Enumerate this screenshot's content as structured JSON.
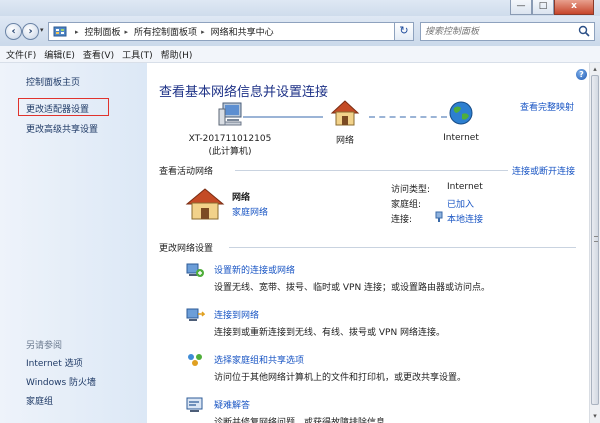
{
  "window": {
    "minimize": "—",
    "maximize": "□",
    "close": "x"
  },
  "address": {
    "crumbs": [
      "控制面板",
      "所有控制面板项",
      "网络和共享中心"
    ],
    "search_placeholder": "搜索控制面板"
  },
  "menu": [
    "文件(F)",
    "编辑(E)",
    "查看(V)",
    "工具(T)",
    "帮助(H)"
  ],
  "sidebar": {
    "links": [
      "控制面板主页",
      "更改适配器设置",
      "更改高级共享设置"
    ],
    "see_also_title": "另请参阅",
    "see_also": [
      "Internet 选项",
      "Windows 防火墙",
      "家庭组"
    ]
  },
  "main": {
    "title": "查看基本网络信息并设置连接",
    "full_map_link": "查看完整映射",
    "nodes": {
      "computer_name": "XT-201711012105",
      "computer_sub": "(此计算机)",
      "network": "网络",
      "internet": "Internet"
    },
    "active_section": {
      "heading": "查看活动网络",
      "connect_link": "连接或断开连接",
      "network_name": "网络",
      "network_type": "家庭网络",
      "access_label": "访问类型:",
      "access_value": "Internet",
      "homegroup_label": "家庭组:",
      "homegroup_value": "已加入",
      "connection_label": "连接:",
      "connection_value": "本地连接"
    },
    "settings_section": {
      "heading": "更改网络设置",
      "tasks": [
        {
          "title": "设置新的连接或网络",
          "desc": "设置无线、宽带、拨号、临时或 VPN 连接；或设置路由器或访问点。"
        },
        {
          "title": "连接到网络",
          "desc": "连接到或重新连接到无线、有线、拨号或 VPN 网络连接。"
        },
        {
          "title": "选择家庭组和共享选项",
          "desc": "访问位于其他网络计算机上的文件和打印机，或更改共享设置。"
        },
        {
          "title": "疑难解答",
          "desc": "诊断并修复网络问题，或获得故障排除信息。"
        }
      ]
    }
  }
}
